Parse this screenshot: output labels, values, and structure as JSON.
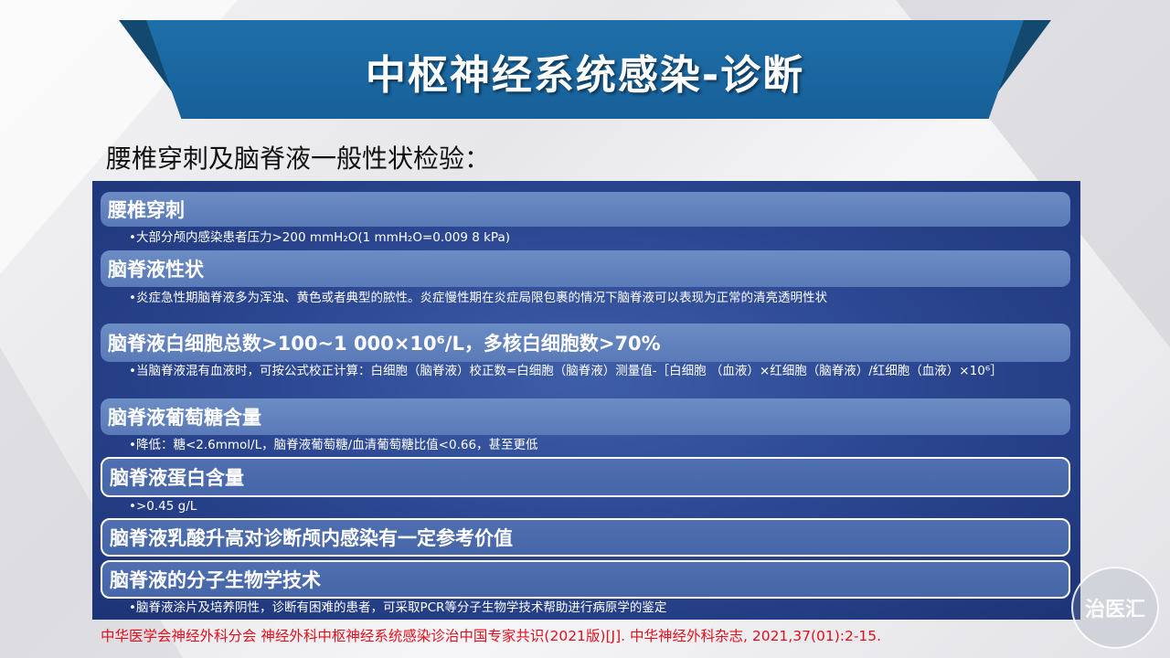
{
  "title": "中枢神经系统感染-诊断",
  "subtitle": "腰椎穿刺及脑脊液一般性状检验：",
  "sections": [
    {
      "heading": "腰椎穿刺",
      "bullet": "•大部分颅内感染患者压力>200 mmH₂O(1  mmH₂O=0.009 8 kPa)"
    },
    {
      "heading": "脑脊液性状",
      "bullet": "•炎症急性期脑脊液多为浑浊、黄色或者典型的脓性。炎症慢性期在炎症局限包裹的情况下脑脊液可以表现为正常的清亮透明性状"
    },
    {
      "heading": "脑脊液白细胞总数>100~1 000×10⁶/L，多核白细胞数>70%",
      "bullet": "•当脑脊液混有血液时，可按公式校正计算：白细胞（脑脊液）校正数=白细胞（脑脊液）测量值-［白细胞 （血液）×红细胞（脑脊液）/红细胞（血液）×10⁶］"
    },
    {
      "heading": "脑脊液葡萄糖含量",
      "bullet": "•降低：糖<2.6mmol/L，脑脊液葡萄糖/血清葡萄糖比值<0.66，甚至更低"
    },
    {
      "heading": "脑脊液蛋白含量",
      "bullet": "•>0.45 g/L"
    },
    {
      "heading": "脑脊液乳酸升高对诊断颅内感染有一定参考价值",
      "bullet": ""
    },
    {
      "heading": "脑脊液的分子生物学技术",
      "bullet": "•脑脊液涂片及培养阴性，诊断有困难的患者，可采取PCR等分子生物学技术帮助进行病原学的鉴定"
    }
  ],
  "citation": "中华医学会神经外科分会 神经外科中枢神经系统感染诊治中国专家共识(2021版)[J]. 中华神经外科杂志, 2021,37(01):2-15.",
  "watermark": "治医汇"
}
